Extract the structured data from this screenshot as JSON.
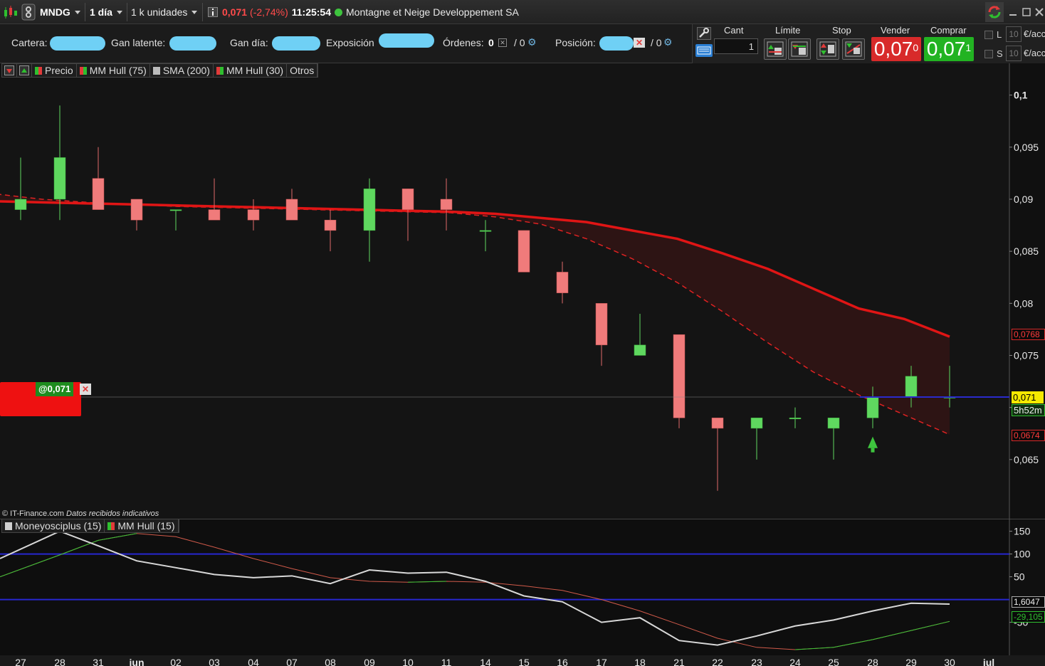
{
  "toolbar": {
    "symbol": "MNDG",
    "period": "1 día",
    "units": "1 k unidades",
    "last_price": "0,071",
    "change": "(-2,74%)",
    "time": "11:25:54",
    "company": "Montagne et Neige Developpement SA",
    "status_color": "#3ec43e"
  },
  "account": {
    "cartera_label": "Cartera:",
    "gan_latente_label": "Gan latente:",
    "gan_dia_label": "Gan día:",
    "exposicion_label": "Exposición",
    "ordenes_label": "Órdenes:",
    "ordenes_value": "0",
    "ordenes_pending": "/ 0",
    "posicion_label": "Posición:",
    "posicion_pending": "/ 0"
  },
  "order_panel": {
    "cant_label": "Cant",
    "cant_value": "1",
    "limite_label": "Límite",
    "stop_label": "Stop",
    "vender_label": "Vender",
    "comprar_label": "Comprar",
    "sell_price": "0,07",
    "sell_sup": "0",
    "buy_price": "0,07",
    "buy_sup": "1",
    "l_label": "L",
    "s_label": "S",
    "l_qty": "10",
    "s_qty": "10",
    "unit_label": "€/acc",
    "sell_color": "#d82a2a",
    "buy_color": "#22b322"
  },
  "legend_main": {
    "precio": "Precio",
    "mm_hull_75": "MM Hull (75)",
    "sma_200": "SMA (200)",
    "mm_hull_30": "MM Hull (30)",
    "otros": "Otros"
  },
  "legend_osc": {
    "moneyosciplus": "Moneyosciplus (15)",
    "mm_hull_15": "MM Hull (15)"
  },
  "position_tag": "@0,071",
  "credit": "© IT-Finance.com",
  "credit_note": "Datos recibidos indicativos",
  "price_tags": {
    "hull_tag": "0,0768",
    "last_tag": "0,071",
    "countdown": "5h52m",
    "lower_tag": "0,0674",
    "osc_tag1": "1,6047",
    "osc_tag2": "-29,105"
  },
  "chart_data": [
    {
      "type": "candlestick",
      "x": [
        "27",
        "28",
        "31",
        "jun",
        "02",
        "03",
        "04",
        "07",
        "08",
        "09",
        "10",
        "11",
        "14",
        "15",
        "16",
        "17",
        "18",
        "21",
        "22",
        "23",
        "24",
        "25",
        "28",
        "29",
        "30",
        "jul"
      ],
      "ohlc": [
        {
          "d": "27",
          "o": 0.089,
          "h": 0.094,
          "l": 0.088,
          "c": 0.09
        },
        {
          "d": "28",
          "o": 0.09,
          "h": 0.099,
          "l": 0.088,
          "c": 0.094
        },
        {
          "d": "31",
          "o": 0.092,
          "h": 0.095,
          "l": 0.089,
          "c": 0.089
        },
        {
          "d": "jun",
          "o": 0.09,
          "h": 0.09,
          "l": 0.087,
          "c": 0.088
        },
        {
          "d": "02",
          "o": 0.089,
          "h": 0.089,
          "l": 0.087,
          "c": 0.089
        },
        {
          "d": "03",
          "o": 0.089,
          "h": 0.092,
          "l": 0.088,
          "c": 0.088
        },
        {
          "d": "04",
          "o": 0.089,
          "h": 0.09,
          "l": 0.087,
          "c": 0.088
        },
        {
          "d": "07",
          "o": 0.09,
          "h": 0.091,
          "l": 0.088,
          "c": 0.088
        },
        {
          "d": "08",
          "o": 0.088,
          "h": 0.089,
          "l": 0.085,
          "c": 0.087
        },
        {
          "d": "09",
          "o": 0.087,
          "h": 0.092,
          "l": 0.084,
          "c": 0.091
        },
        {
          "d": "10",
          "o": 0.091,
          "h": 0.091,
          "l": 0.086,
          "c": 0.089
        },
        {
          "d": "11",
          "o": 0.09,
          "h": 0.092,
          "l": 0.087,
          "c": 0.089
        },
        {
          "d": "14",
          "o": 0.087,
          "h": 0.088,
          "l": 0.085,
          "c": 0.087
        },
        {
          "d": "15",
          "o": 0.087,
          "h": 0.087,
          "l": 0.083,
          "c": 0.083
        },
        {
          "d": "16",
          "o": 0.083,
          "h": 0.084,
          "l": 0.08,
          "c": 0.081
        },
        {
          "d": "17",
          "o": 0.08,
          "h": 0.08,
          "l": 0.074,
          "c": 0.076
        },
        {
          "d": "18",
          "o": 0.075,
          "h": 0.079,
          "l": 0.075,
          "c": 0.076
        },
        {
          "d": "21",
          "o": 0.077,
          "h": 0.077,
          "l": 0.068,
          "c": 0.069
        },
        {
          "d": "22",
          "o": 0.069,
          "h": 0.069,
          "l": 0.062,
          "c": 0.068
        },
        {
          "d": "23",
          "o": 0.068,
          "h": 0.069,
          "l": 0.065,
          "c": 0.069
        },
        {
          "d": "24",
          "o": 0.069,
          "h": 0.07,
          "l": 0.068,
          "c": 0.069
        },
        {
          "d": "25",
          "o": 0.068,
          "h": 0.069,
          "l": 0.065,
          "c": 0.069
        },
        {
          "d": "28",
          "o": 0.069,
          "h": 0.072,
          "l": 0.068,
          "c": 0.071
        },
        {
          "d": "29",
          "o": 0.071,
          "h": 0.074,
          "l": 0.07,
          "c": 0.073
        },
        {
          "d": "30",
          "o": 0.071,
          "h": 0.074,
          "l": 0.07,
          "c": 0.071
        }
      ],
      "hull75": [
        0.0898,
        0.0897,
        0.0896,
        0.0895,
        0.0894,
        0.0893,
        0.0892,
        0.0891,
        0.089,
        0.0889,
        0.0888,
        0.0886,
        0.0882,
        0.0878,
        0.087,
        0.0862,
        0.0848,
        0.0833,
        0.0814,
        0.0795,
        0.0785,
        0.0768
      ],
      "hull30": [
        0.0905,
        0.09,
        0.0897,
        0.0895,
        0.0893,
        0.0892,
        0.0891,
        0.089,
        0.0889,
        0.0888,
        0.0887,
        0.0883,
        0.0876,
        0.0862,
        0.0843,
        0.082,
        0.0792,
        0.0762,
        0.0734,
        0.0712,
        0.0693,
        0.0674
      ],
      "ylim": [
        0.06,
        0.101
      ],
      "yticks": [
        "0,065",
        "0,07",
        "0,075",
        "0,08",
        "0,085",
        "0,09",
        "0,095",
        "0,1"
      ]
    },
    {
      "type": "line",
      "series": [
        {
          "values": [
            90,
            150,
            118,
            85,
            70,
            55,
            48,
            52,
            35,
            65,
            58,
            60,
            40,
            8,
            -5,
            -50,
            -40,
            -90,
            -100,
            -80,
            -58,
            -45,
            -25,
            -8,
            -10
          ]
        },
        {
          "values": [
            50,
            98,
            130,
            145,
            138,
            115,
            90,
            68,
            48,
            40,
            38,
            40,
            38,
            30,
            20,
            0,
            -25,
            -55,
            -85,
            -105,
            -110,
            -105,
            -88,
            -68,
            -48
          ]
        }
      ],
      "hlines": [
        100,
        0
      ],
      "ylim": [
        -110,
        165
      ],
      "yticks": [
        "150",
        "100",
        "50",
        "-50"
      ]
    }
  ]
}
